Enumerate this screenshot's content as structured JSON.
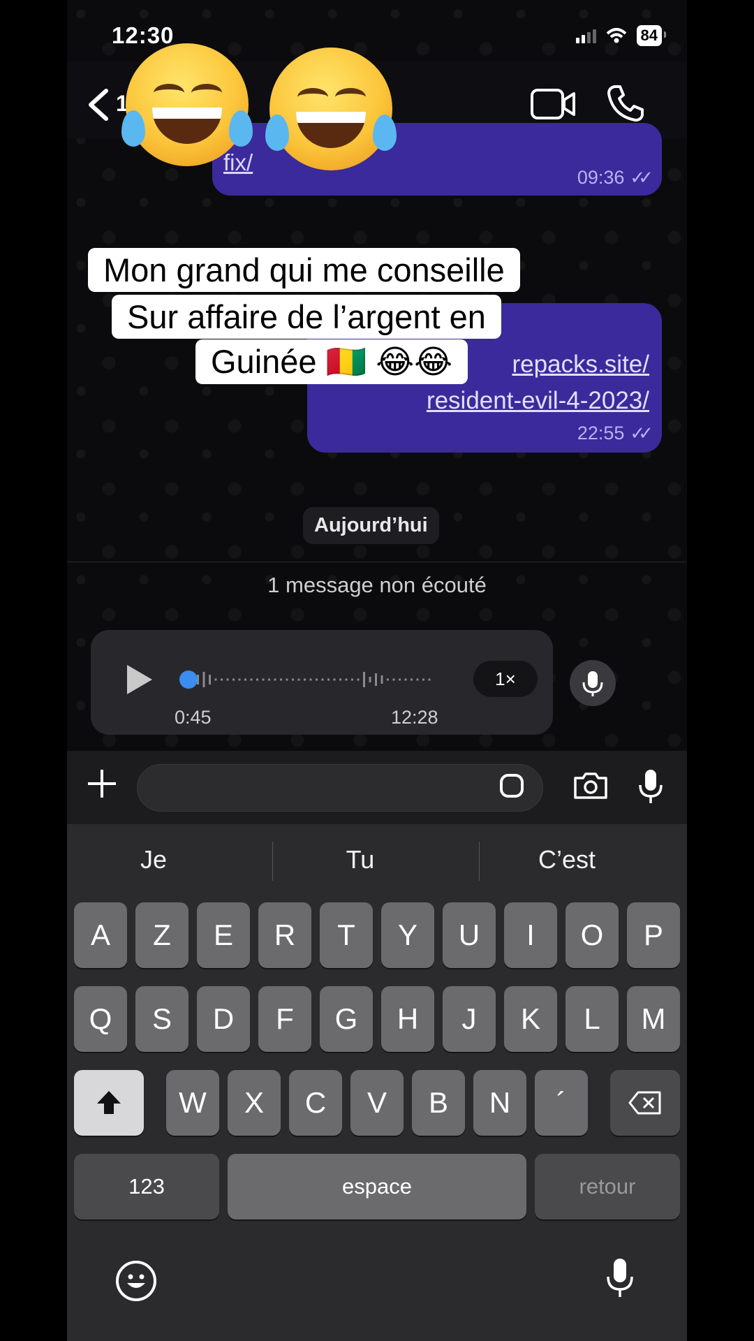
{
  "status_bar": {
    "time": "12:30",
    "battery": "84"
  },
  "header": {
    "back_label": "<",
    "contact_name": "1"
  },
  "messages": [
    {
      "link_text": "fix/",
      "time": "09:36"
    },
    {
      "link_text": "repacks.site/\nresident-evil-4-2023/",
      "time": "22:55"
    }
  ],
  "caption": {
    "line1": "Mon grand qui me conseille",
    "line2": "Sur affaire de l’argent en",
    "line3": "Guinée 🇬🇳 😂😂"
  },
  "day_separator": "Aujourd’hui",
  "unread_banner": "1 message non écouté",
  "voice_message": {
    "elapsed": "0:45",
    "recorded_at": "12:28",
    "speed": "1×",
    "progress": 0.02
  },
  "keyboard": {
    "suggestions": [
      "Je",
      "Tu",
      "C’est"
    ],
    "row1": [
      "A",
      "Z",
      "E",
      "R",
      "T",
      "Y",
      "U",
      "I",
      "O",
      "P"
    ],
    "row2": [
      "Q",
      "S",
      "D",
      "F",
      "G",
      "H",
      "J",
      "K",
      "L",
      "M"
    ],
    "row3": [
      "W",
      "X",
      "C",
      "V",
      "B",
      "N",
      "´"
    ],
    "numbers_label": "123",
    "space_label": "espace",
    "return_label": "retour"
  },
  "colors": {
    "bubble": "#3b2a9b",
    "voice_progress": "#3b8df0",
    "keyboard_bg": "#2b2b2d"
  }
}
